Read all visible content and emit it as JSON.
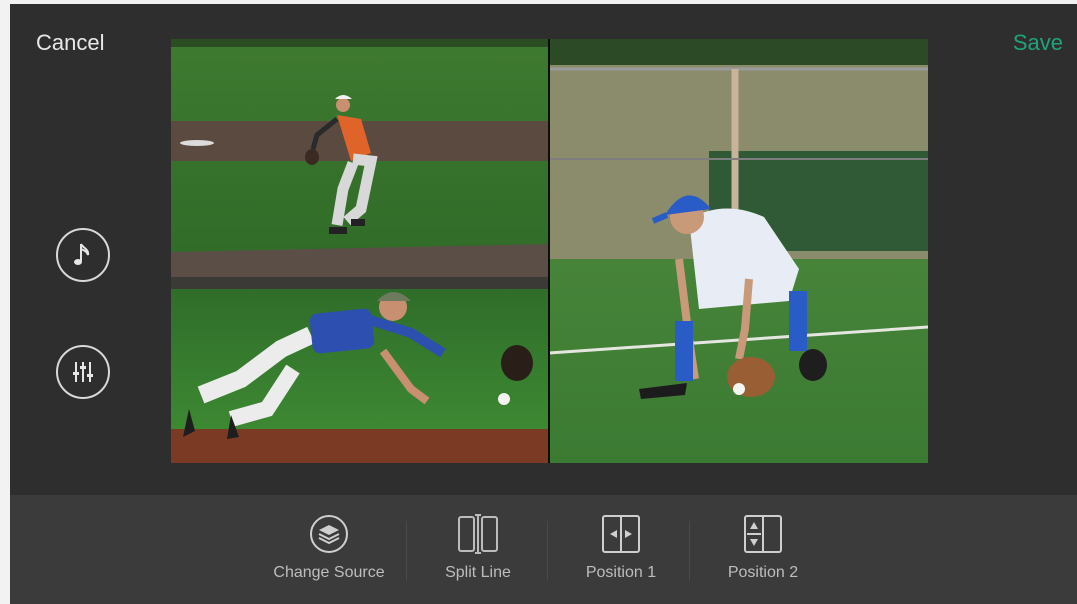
{
  "header": {
    "cancel_label": "Cancel",
    "save_label": "Save",
    "save_color": "#1fa37a"
  },
  "side_controls": [
    {
      "name": "music-button",
      "icon": "music-note-icon"
    },
    {
      "name": "audio-mixer-button",
      "icon": "sliders-icon"
    }
  ],
  "preview": {
    "layout": "split-screen",
    "clips": [
      {
        "name": "left-clip",
        "icon": "video-frame"
      },
      {
        "name": "right-clip",
        "icon": "video-frame"
      }
    ]
  },
  "toolbar": {
    "items": [
      {
        "label": "Change Source",
        "icon": "layers-icon"
      },
      {
        "label": "Split Line",
        "icon": "split-line-icon"
      },
      {
        "label": "Position 1",
        "icon": "horizontal-arrows-icon"
      },
      {
        "label": "Position 2",
        "icon": "vertical-arrows-icon"
      }
    ]
  }
}
